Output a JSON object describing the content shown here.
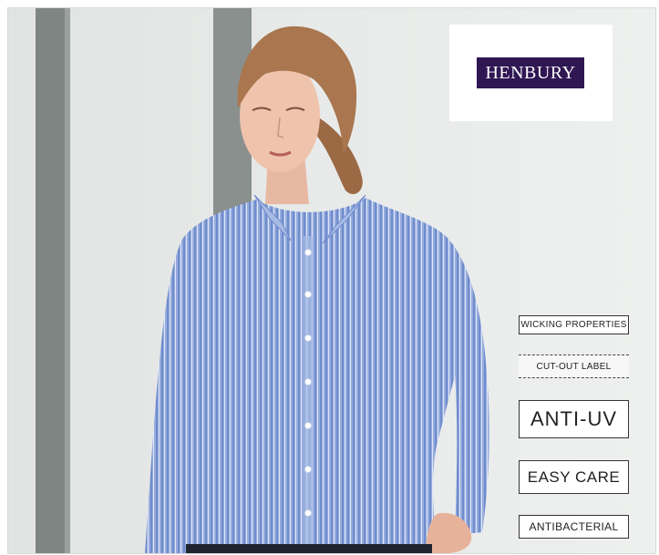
{
  "brand": {
    "name": "HENBURY",
    "color": "#2f1753"
  },
  "features": [
    "WICKING PROPERTIES",
    "CUT-OUT LABEL",
    "ANTI-UV",
    "EASY CARE",
    "ANTIBACTERIAL"
  ],
  "colors": {
    "shirt": "#8fa6da",
    "background": "#e9ebea",
    "hair": "#a9764f"
  }
}
